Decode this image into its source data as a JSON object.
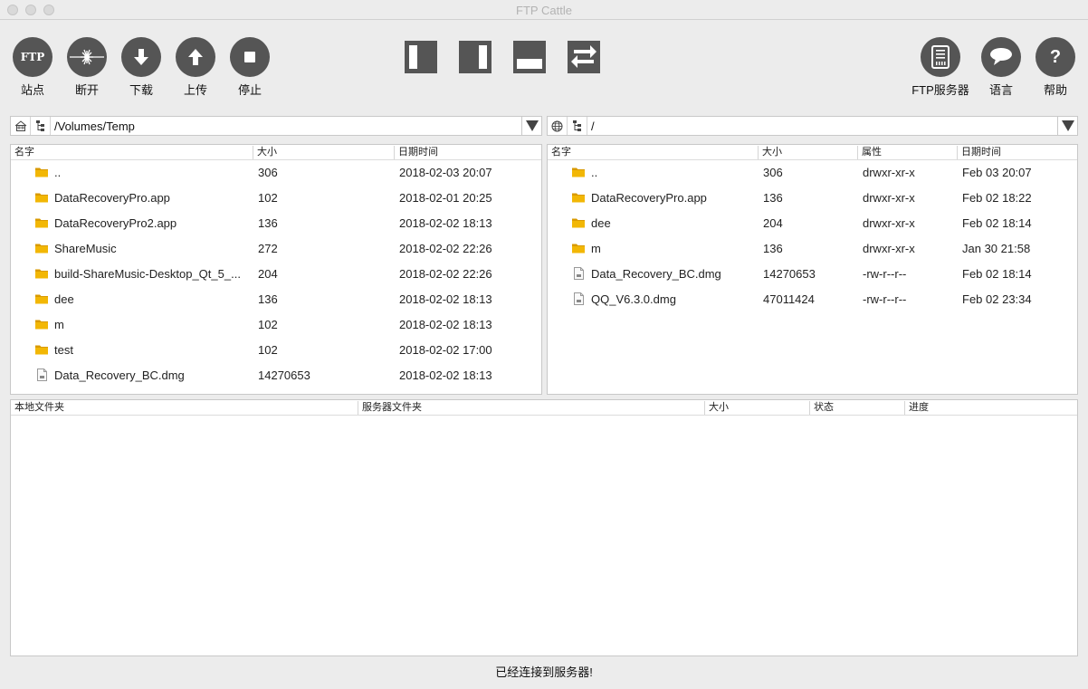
{
  "window": {
    "title": "FTP Cattle"
  },
  "toolbar": {
    "left": [
      {
        "label": "站点",
        "icon": "ftp-site-icon"
      },
      {
        "label": "断开",
        "icon": "disconnect-icon"
      },
      {
        "label": "下载",
        "icon": "download-arrow-icon"
      },
      {
        "label": "上传",
        "icon": "upload-arrow-icon"
      },
      {
        "label": "停止",
        "icon": "stop-icon"
      }
    ],
    "layout": [
      "layout-left-pane-icon",
      "layout-right-pane-icon",
      "layout-bottom-pane-icon",
      "swap-panes-icon"
    ],
    "right": [
      {
        "label": "FTP服务器",
        "icon": "ftp-server-icon"
      },
      {
        "label": "语言",
        "icon": "language-bubble-icon"
      },
      {
        "label": "帮助",
        "icon": "help-icon"
      }
    ],
    "icon_bg": "#555555"
  },
  "local": {
    "path": "/Volumes/Temp",
    "columns": [
      "名字",
      "大小",
      "日期时间"
    ],
    "files": [
      {
        "name": "..",
        "size": "306",
        "date": "2018-02-03 20:07",
        "type": "folder"
      },
      {
        "name": "DataRecoveryPro.app",
        "size": "102",
        "date": "2018-02-01 20:25",
        "type": "folder"
      },
      {
        "name": "DataRecoveryPro2.app",
        "size": "136",
        "date": "2018-02-02 18:13",
        "type": "folder"
      },
      {
        "name": "ShareMusic",
        "size": "272",
        "date": "2018-02-02 22:26",
        "type": "folder"
      },
      {
        "name": "build-ShareMusic-Desktop_Qt_5_...",
        "size": "204",
        "date": "2018-02-02 22:26",
        "type": "folder"
      },
      {
        "name": "dee",
        "size": "136",
        "date": "2018-02-02 18:13",
        "type": "folder"
      },
      {
        "name": "m",
        "size": "102",
        "date": "2018-02-02 18:13",
        "type": "folder"
      },
      {
        "name": "test",
        "size": "102",
        "date": "2018-02-02 17:00",
        "type": "folder"
      },
      {
        "name": "Data_Recovery_BC.dmg",
        "size": "14270653",
        "date": "2018-02-02 18:13",
        "type": "file"
      }
    ]
  },
  "remote": {
    "path": "/",
    "columns": [
      "名字",
      "大小",
      "属性",
      "日期时间"
    ],
    "files": [
      {
        "name": "..",
        "size": "306",
        "attr": "drwxr-xr-x",
        "date": "Feb 03 20:07",
        "type": "folder"
      },
      {
        "name": "DataRecoveryPro.app",
        "size": "136",
        "attr": "drwxr-xr-x",
        "date": "Feb 02 18:22",
        "type": "folder"
      },
      {
        "name": "dee",
        "size": "204",
        "attr": "drwxr-xr-x",
        "date": "Feb 02 18:14",
        "type": "folder"
      },
      {
        "name": "m",
        "size": "136",
        "attr": "drwxr-xr-x",
        "date": "Jan 30 21:58",
        "type": "folder"
      },
      {
        "name": "Data_Recovery_BC.dmg",
        "size": "14270653",
        "attr": "-rw-r--r--",
        "date": "Feb 02 18:14",
        "type": "file"
      },
      {
        "name": "QQ_V6.3.0.dmg",
        "size": "47011424",
        "attr": "-rw-r--r--",
        "date": "Feb 02 23:34",
        "type": "file"
      }
    ]
  },
  "queue": {
    "columns": [
      "本地文件夹",
      "服务器文件夹",
      "大小",
      "状态",
      "进度"
    ]
  },
  "status": {
    "text": "已经连接到服务器!"
  },
  "colors": {
    "folder": "#f2b705",
    "folder_dark": "#d99a00"
  }
}
